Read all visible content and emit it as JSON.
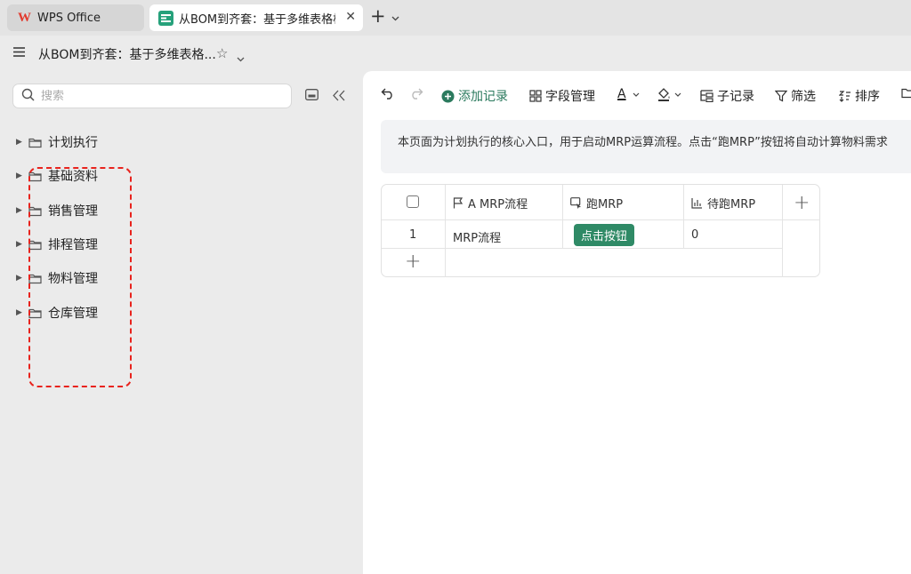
{
  "tabs": {
    "wps_label": "WPS Office",
    "doc_label": "从BOM到齐套：基于多维表格构建",
    "wps_logo": "W"
  },
  "header": {
    "doc_title": "从BOM到齐套：基于多维表格..."
  },
  "sidebar": {
    "search_placeholder": "搜索",
    "items": [
      {
        "label": "计划执行"
      },
      {
        "label": "基础资料"
      },
      {
        "label": "销售管理"
      },
      {
        "label": "排程管理"
      },
      {
        "label": "物料管理"
      },
      {
        "label": "仓库管理"
      }
    ],
    "highlight_color": "#e8231d"
  },
  "toolbar": {
    "add_record": "添加记录",
    "field_manage": "字段管理",
    "text_color_glyph": "A",
    "sub_record": "子记录",
    "filter": "筛选",
    "sort": "排序"
  },
  "notice": {
    "text": "本页面为计划执行的核心入口，用于启动MRP运算流程。点击“跑MRP”按钮将自动计算物料需求"
  },
  "table": {
    "columns": [
      {
        "label": "A  MRP流程",
        "icon": "flag-icon"
      },
      {
        "label": "跑MRP",
        "icon": "button-field-icon"
      },
      {
        "label": "待跑MRP",
        "icon": "number-field-icon"
      }
    ],
    "rows": [
      {
        "index": "1",
        "mrp_flow": "MRP流程",
        "run_button": "点击按钮",
        "pending": "0"
      }
    ],
    "accent": "#2f8a66"
  }
}
